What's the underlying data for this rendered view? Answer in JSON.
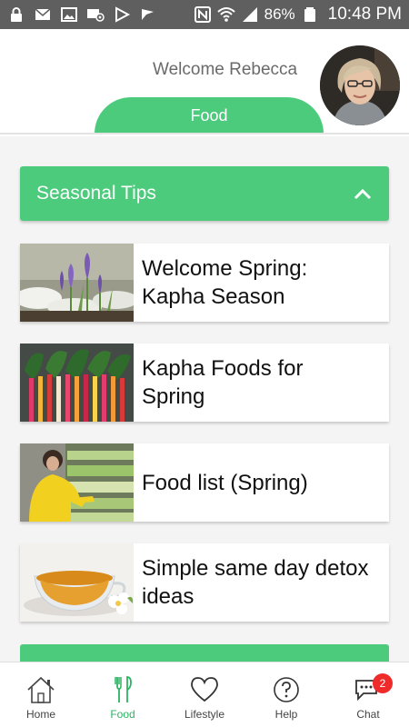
{
  "status_bar": {
    "battery": "86%",
    "time": "10:48 PM",
    "icons": [
      "lock-icon",
      "mail-icon",
      "image-icon",
      "email-at-icon",
      "play-store-icon",
      "checkmark-flag-icon",
      "nfc-icon",
      "wifi-icon",
      "signal-icon",
      "battery-icon"
    ]
  },
  "header": {
    "welcome": "Welcome Rebecca",
    "active_tab": "Food"
  },
  "section": {
    "title": "Seasonal Tips",
    "expanded": true
  },
  "cards": [
    {
      "title_line1": "Welcome Spring:",
      "title_line2": "Kapha Season",
      "image": "crocus-flowers"
    },
    {
      "title_line1": "Kapha Foods for",
      "title_line2": "Spring",
      "image": "rainbow-chard"
    },
    {
      "title_line1": "Food list (Spring)",
      "title_line2": "",
      "image": "grocery-shopper"
    },
    {
      "title_line1": "Simple same day detox",
      "title_line2": "ideas",
      "image": "tea-cup"
    }
  ],
  "nav": {
    "items": [
      {
        "label": "Home",
        "icon": "home-icon",
        "active": false
      },
      {
        "label": "Food",
        "icon": "fork-knife-icon",
        "active": true
      },
      {
        "label": "Lifestyle",
        "icon": "heart-icon",
        "active": false
      },
      {
        "label": "Help",
        "icon": "help-icon",
        "active": false
      },
      {
        "label": "Chat",
        "icon": "chat-icon",
        "active": false,
        "badge": "2"
      }
    ]
  },
  "colors": {
    "accent": "#4ccb7c",
    "active_nav": "#2bb463",
    "status_bar": "#5f5f5f",
    "badge": "#ee2a2a"
  }
}
